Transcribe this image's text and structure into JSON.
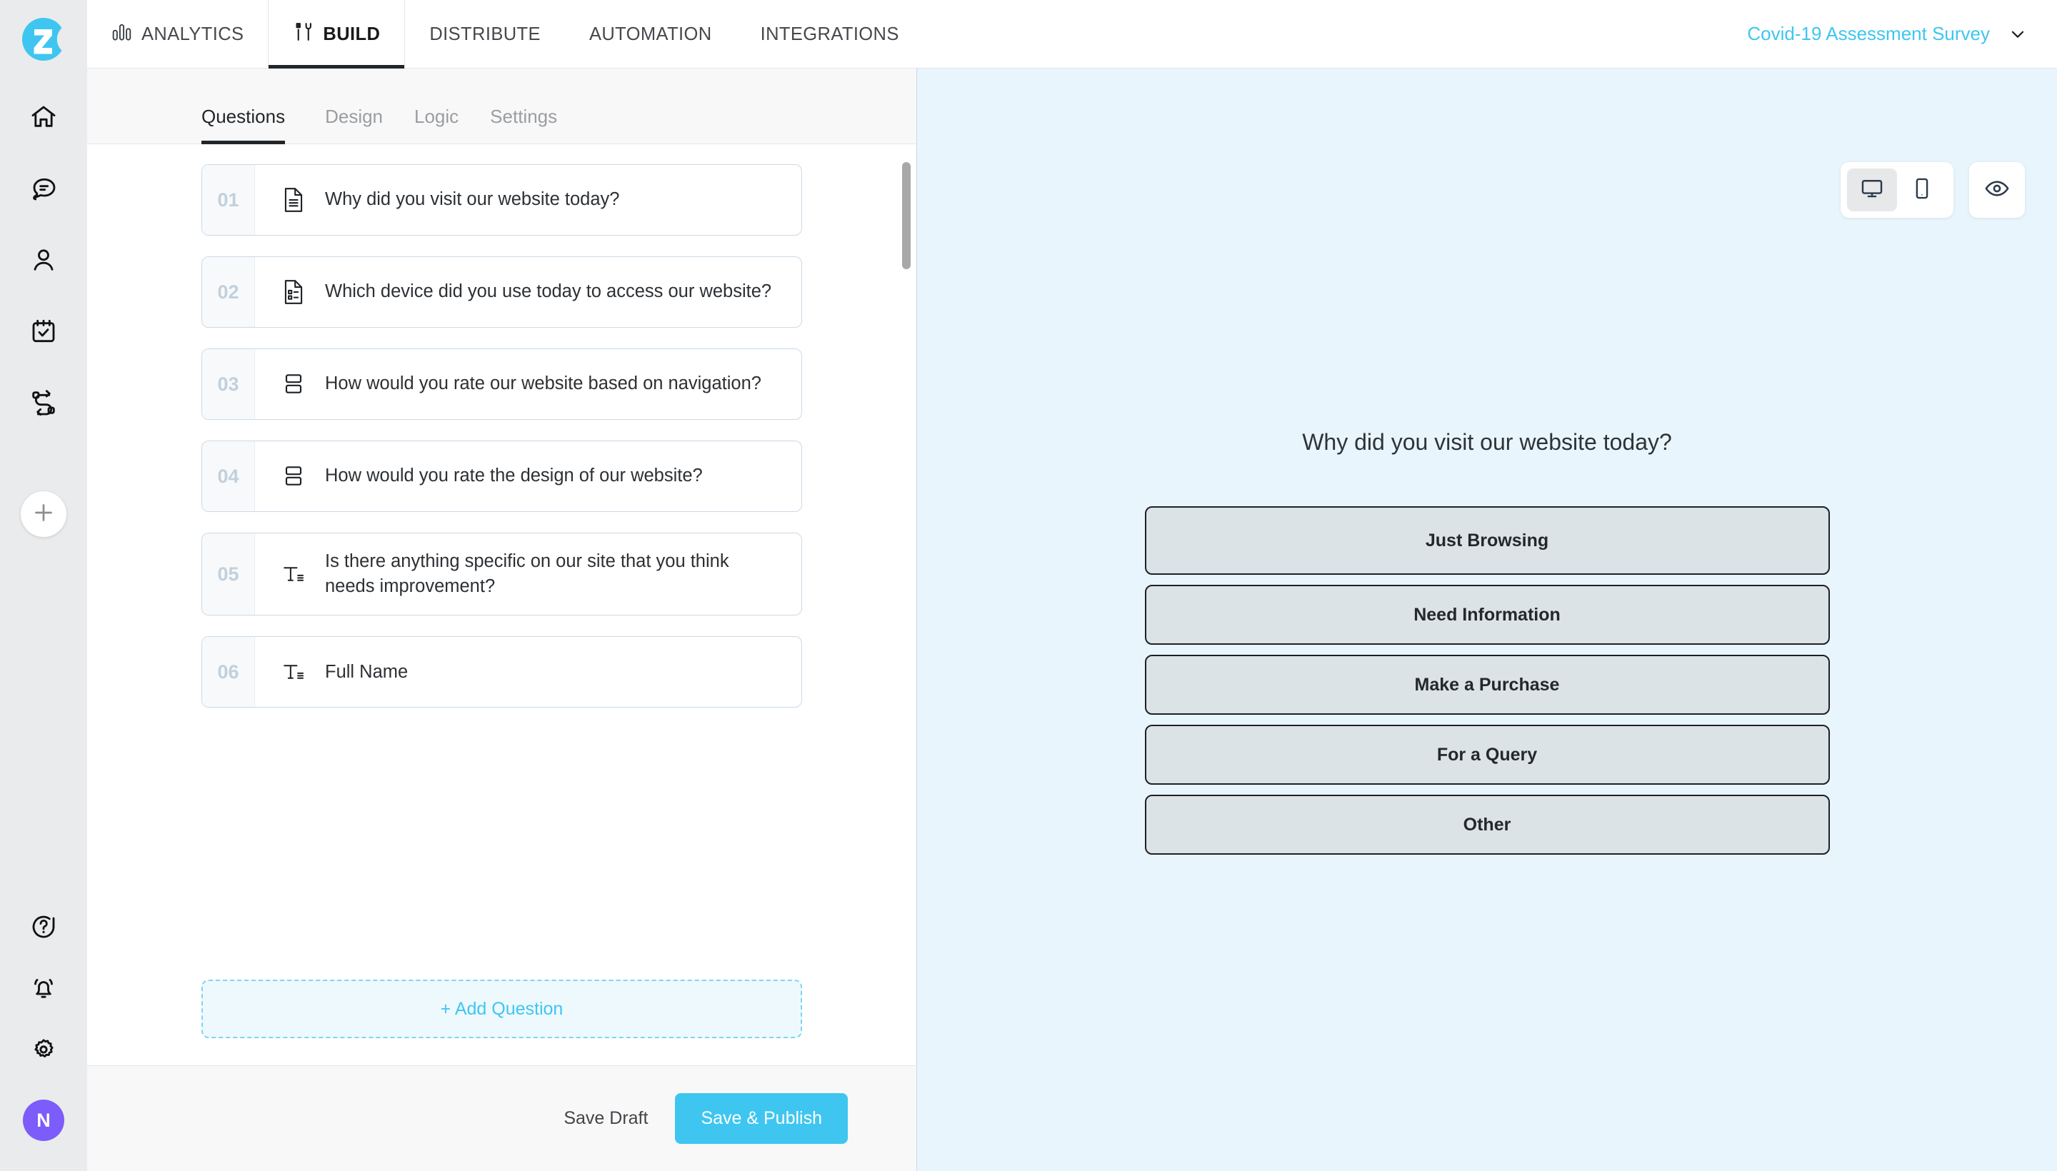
{
  "brand": {
    "logo_letter": "Z",
    "accent_color": "#3ec6f0",
    "avatar_color": "#7c5cfa"
  },
  "rail": {
    "items": [
      {
        "icon": "home-icon",
        "name": "home"
      },
      {
        "icon": "chat-icon",
        "name": "conversations"
      },
      {
        "icon": "user-icon",
        "name": "contacts"
      },
      {
        "icon": "calendar-check-icon",
        "name": "appointments"
      },
      {
        "icon": "workflow-icon",
        "name": "workflows"
      }
    ],
    "add_button": {
      "icon": "plus-icon",
      "label": "+"
    },
    "bottom_items": [
      {
        "icon": "help-circle-icon",
        "name": "help"
      },
      {
        "icon": "bell-icon",
        "name": "notifications"
      },
      {
        "icon": "gear-icon",
        "name": "settings"
      }
    ],
    "avatar_initial": "N"
  },
  "topnav": {
    "tabs": [
      {
        "label": "ANALYTICS",
        "icon": "bar-chart-icon",
        "active": false
      },
      {
        "label": "BUILD",
        "icon": "tools-icon",
        "active": true
      },
      {
        "label": "DISTRIBUTE",
        "icon": "",
        "active": false
      },
      {
        "label": "AUTOMATION",
        "icon": "",
        "active": false
      },
      {
        "label": "INTEGRATIONS",
        "icon": "",
        "active": false
      }
    ],
    "survey_name": "Covid-19 Assessment Survey",
    "survey_dropdown_icon": "chevron-down-icon"
  },
  "builder": {
    "subtabs": [
      {
        "label": "Questions",
        "active": true
      },
      {
        "label": "Design",
        "active": false
      },
      {
        "label": "Logic",
        "active": false
      },
      {
        "label": "Settings",
        "active": false
      }
    ],
    "questions": [
      {
        "number": "01",
        "text": "Why did you visit our website today?",
        "icon": "document-lines-icon"
      },
      {
        "number": "02",
        "text": "Which device did you use today to access our website?",
        "icon": "document-list-icon"
      },
      {
        "number": "03",
        "text": "How would you rate our website based on navigation?",
        "icon": "stacked-boxes-icon"
      },
      {
        "number": "04",
        "text": "How would you rate the design of our website?",
        "icon": "stacked-boxes-icon"
      },
      {
        "number": "05",
        "text": "Is there anything specific on our site that you think needs improvement?",
        "icon": "text-field-icon"
      },
      {
        "number": "06",
        "text": "Full Name",
        "icon": "text-field-icon"
      }
    ],
    "add_question_label": "+ Add Question",
    "footer": {
      "save_draft_label": "Save Draft",
      "save_publish_label": "Save & Publish"
    }
  },
  "preview": {
    "device_modes": [
      {
        "name": "desktop",
        "icon": "monitor-icon",
        "selected": true
      },
      {
        "name": "mobile",
        "icon": "phone-icon",
        "selected": false
      }
    ],
    "preview_button_icon": "eye-icon",
    "question_title": "Why did you visit our website today?",
    "options": [
      "Just Browsing",
      "Need Information",
      "Make a Purchase",
      "For a Query",
      "Other"
    ]
  }
}
